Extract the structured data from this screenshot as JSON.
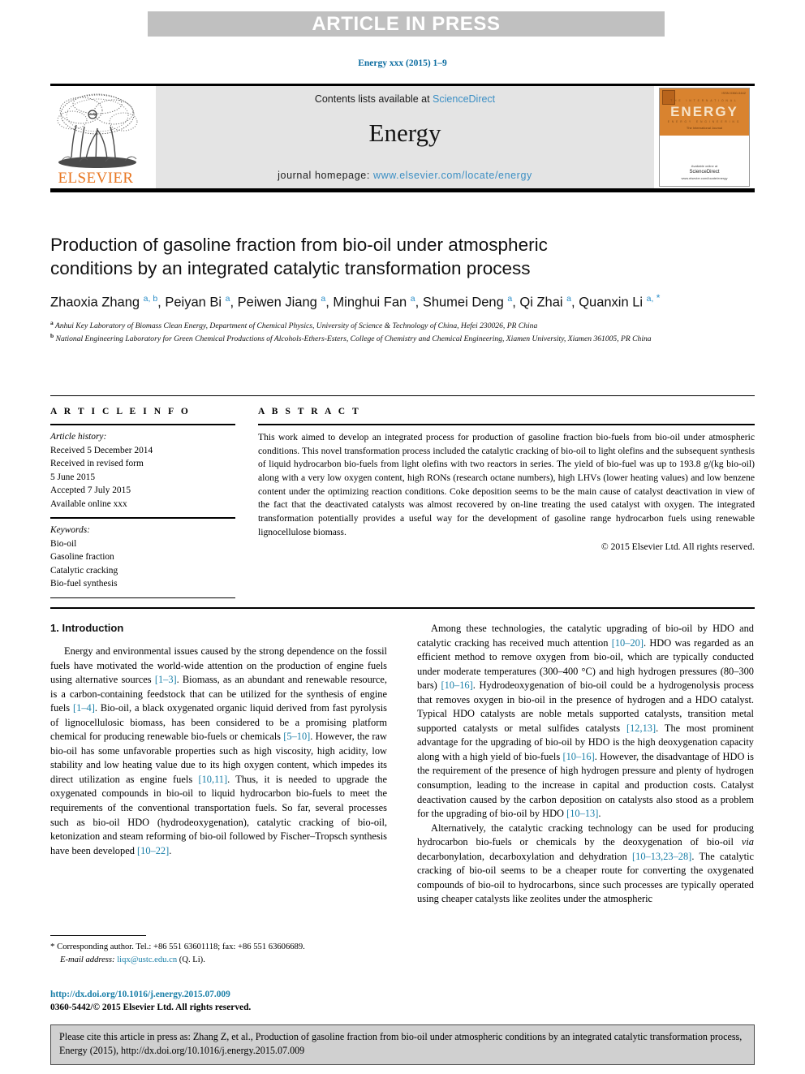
{
  "banner": {
    "text": "ARTICLE IN PRESS"
  },
  "journal_ref": "Energy xxx (2015) 1–9",
  "masthead": {
    "contents_prefix": "Contents lists available at ",
    "sciencedirect": "ScienceDirect",
    "journal_title": "Energy",
    "homepage_prefix": "journal homepage: ",
    "homepage_url": "www.elsevier.com/locate/energy",
    "publisher_wordmark": "ELSEVIER",
    "cover": {
      "title": "ENERGY",
      "issue": "ISSN 0360-5442",
      "strip_top": "THE INTERNATIONAL JOURNAL",
      "strip_bottom": "ENERGY ENGINEERING SCIENCE POLICY",
      "subtitle": "The International Journal",
      "footer_line1": "Available online at",
      "footer_brand": "ScienceDirect",
      "footer_line2": "www.elsevier.com/locate/energy"
    }
  },
  "article": {
    "title_line1": "Production of gasoline fraction from bio-oil under atmospheric",
    "title_line2": "conditions by an integrated catalytic transformation process",
    "authors": [
      {
        "name": "Zhaoxia Zhang",
        "marks": "a, b",
        "sep": ", "
      },
      {
        "name": "Peiyan Bi",
        "marks": "a",
        "sep": ", "
      },
      {
        "name": "Peiwen Jiang",
        "marks": "a",
        "sep": ", "
      },
      {
        "name": "Minghui Fan",
        "marks": "a",
        "sep": ", "
      },
      {
        "name": "Shumei Deng",
        "marks": "a",
        "sep": ", "
      },
      {
        "name": "Qi Zhai",
        "marks": "a",
        "sep": ", "
      },
      {
        "name": "Quanxin Li",
        "marks": "a,",
        "corr": "*",
        "sep": ""
      }
    ],
    "affiliations": [
      {
        "mark": "a",
        "text": "Anhui Key Laboratory of Biomass Clean Energy, Department of Chemical Physics, University of Science & Technology of China, Hefei 230026, PR China"
      },
      {
        "mark": "b",
        "text": "National Engineering Laboratory for Green Chemical Productions of Alcohols-Ethers-Esters, College of Chemistry and Chemical Engineering, Xiamen University, Xiamen 361005, PR China"
      }
    ]
  },
  "article_info": {
    "heading": "A R T I C L E   I N F O",
    "history_label": "Article history:",
    "history_lines": [
      "Received 5 December 2014",
      "Received in revised form",
      "5 June 2015",
      "Accepted 7 July 2015",
      "Available online xxx"
    ],
    "keywords_label": "Keywords:",
    "keywords": [
      "Bio-oil",
      "Gasoline fraction",
      "Catalytic cracking",
      "Bio-fuel synthesis"
    ]
  },
  "abstract": {
    "heading": "A B S T R A C T",
    "text": "This work aimed to develop an integrated process for production of gasoline fraction bio-fuels from bio-oil under atmospheric conditions. This novel transformation process included the catalytic cracking of bio-oil to light olefins and the subsequent synthesis of liquid hydrocarbon bio-fuels from light olefins with two reactors in series. The yield of bio-fuel was up to 193.8 g/(kg bio-oil) along with a very low oxygen content, high RONs (research octane numbers), high LHVs (lower heating values) and low benzene content under the optimizing reaction conditions. Coke deposition seems to be the main cause of catalyst deactivation in view of the fact that the deactivated catalysts was almost recovered by on-line treating the used catalyst with oxygen. The integrated transformation potentially provides a useful way for the development of gasoline range hydrocarbon fuels using renewable lignocellulose biomass.",
    "copyright": "© 2015 Elsevier Ltd. All rights reserved."
  },
  "body": {
    "section1_heading": "1. Introduction",
    "left_paragraphs": [
      {
        "runs": [
          {
            "t": "Energy and environmental issues caused by the strong dependence on the fossil fuels have motivated the world-wide attention on the production of engine fuels using alternative sources "
          },
          {
            "t": "[1–3]",
            "k": "ref"
          },
          {
            "t": ". Biomass, as an abundant and renewable resource, is a carbon-containing feedstock that can be utilized for the synthesis of engine fuels "
          },
          {
            "t": "[1–4]",
            "k": "ref"
          },
          {
            "t": ". Bio-oil, a black oxygenated organic liquid derived from fast pyrolysis of lignocellulosic biomass, has been considered to be a promising platform chemical for producing renewable bio-fuels or chemicals "
          },
          {
            "t": "[5–10]",
            "k": "ref"
          },
          {
            "t": ". However, the raw bio-oil has some unfavorable properties such as high viscosity, high acidity, low stability and low heating value due to its high oxygen content, which impedes its direct utilization as engine fuels "
          },
          {
            "t": "[10,11]",
            "k": "ref"
          },
          {
            "t": ". Thus, it is needed to upgrade the oxygenated compounds in bio-oil to liquid hydrocarbon bio-fuels to meet the requirements of the conventional transportation fuels. So far, several processes such as bio-oil HDO (hydrodeoxygenation), catalytic cracking of bio-oil, ketonization and steam reforming of bio-oil followed by Fischer–Tropsch synthesis have been developed "
          },
          {
            "t": "[10–22]",
            "k": "ref"
          },
          {
            "t": "."
          }
        ]
      }
    ],
    "right_paragraphs": [
      {
        "runs": [
          {
            "t": "Among these technologies, the catalytic upgrading of bio-oil by HDO and catalytic cracking has received much attention "
          },
          {
            "t": "[10–20]",
            "k": "ref"
          },
          {
            "t": ". HDO was regarded as an efficient method to remove oxygen from bio-oil, which are typically conducted under moderate temperatures (300–400 °C) and high hydrogen pressures (80–300 bars) "
          },
          {
            "t": "[10–16]",
            "k": "ref"
          },
          {
            "t": ". Hydrodeoxygenation of bio-oil could be a hydrogenolysis process that removes oxygen in bio-oil in the presence of hydrogen and a HDO catalyst. Typical HDO catalysts are noble metals supported catalysts, transition metal supported catalysts or metal sulfides catalysts "
          },
          {
            "t": "[12,13]",
            "k": "ref"
          },
          {
            "t": ". The most prominent advantage for the upgrading of bio-oil by HDO is the high deoxygenation capacity along with a high yield of bio-fuels "
          },
          {
            "t": "[10–16]",
            "k": "ref"
          },
          {
            "t": ". However, the disadvantage of HDO is the requirement of the presence of high hydrogen pressure and plenty of hydrogen consumption, leading to the increase in capital and production costs. Catalyst deactivation caused by the carbon deposition on catalysts also stood as a problem for the upgrading of bio-oil by HDO "
          },
          {
            "t": "[10–13]",
            "k": "ref"
          },
          {
            "t": "."
          }
        ]
      },
      {
        "runs": [
          {
            "t": "Alternatively, the catalytic cracking technology can be used for producing hydrocarbon bio-fuels or chemicals by the deoxygenation of bio-oil "
          },
          {
            "t": "via",
            "k": "ital"
          },
          {
            "t": " decarbonylation, decarboxylation and dehydration "
          },
          {
            "t": "[10–13,23–28]",
            "k": "ref"
          },
          {
            "t": ". The catalytic cracking of bio-oil seems to be a cheaper route for converting the oxygenated compounds of bio-oil to hydrocarbons, since such processes are typically operated using cheaper catalysts like zeolites under the atmospheric"
          }
        ]
      }
    ]
  },
  "footnote": {
    "star": "*",
    "text_before_email": " Corresponding author. Tel.: +86 551 63601118; fax: +86 551 63606689.",
    "email_label": "E-mail address:",
    "email": "liqx@ustc.edu.cn",
    "email_suffix": " (Q. Li)."
  },
  "footer": {
    "doi": "http://dx.doi.org/10.1016/j.energy.2015.07.009",
    "issn": "0360-5442/© 2015 Elsevier Ltd. All rights reserved."
  },
  "citation_box": {
    "text": "Please cite this article in press as: Zhang Z, et al., Production of gasoline fraction from bio-oil under atmospheric conditions by an integrated catalytic transformation process, Energy (2015), http://dx.doi.org/10.1016/j.energy.2015.07.009"
  },
  "colors": {
    "link": "#1a7fa8",
    "sciencedirect": "#3c8fc4",
    "elsevier_orange": "#e87722",
    "banner_bg": "#c0c0c0",
    "masthead_bg": "#e4e4e4",
    "cite_bg": "#d0d0d0"
  }
}
